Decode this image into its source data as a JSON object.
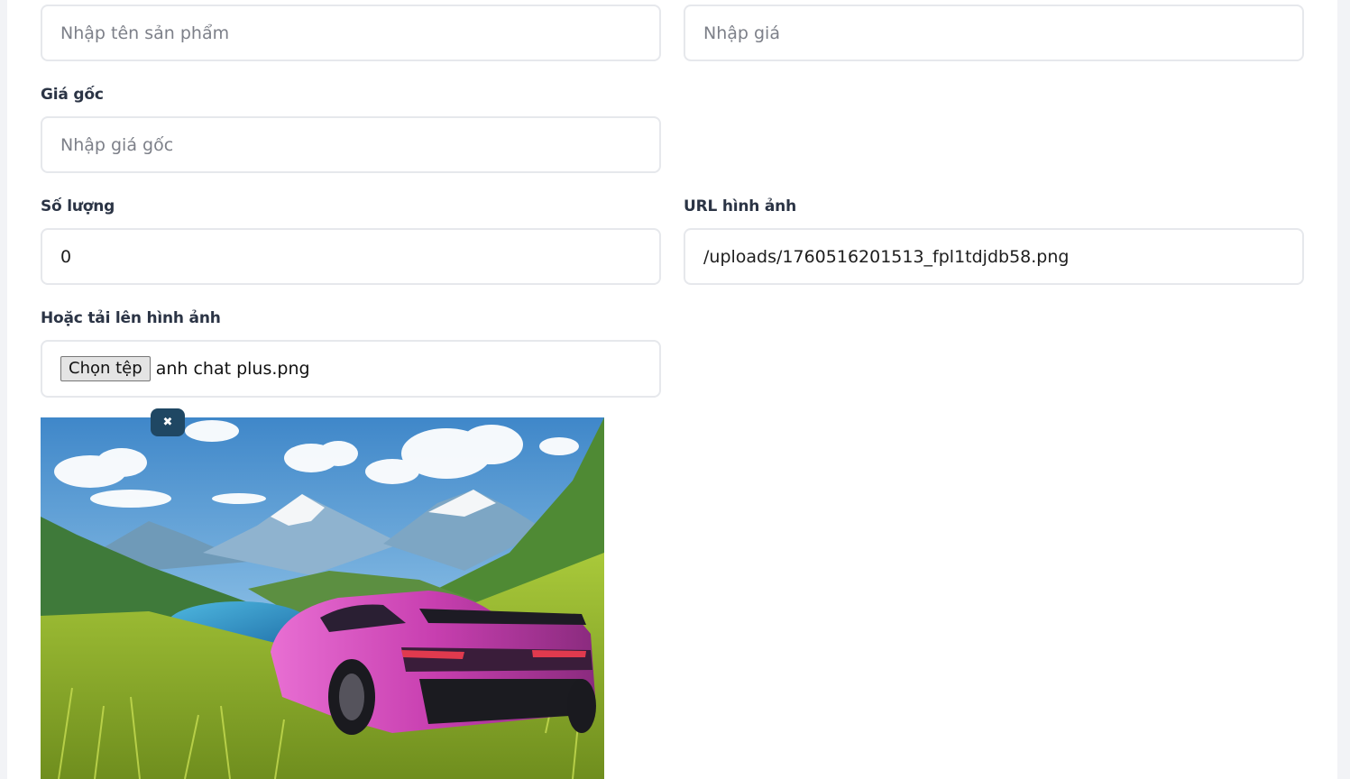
{
  "form": {
    "name_field": {
      "placeholder": "Nhập tên sản phẩm"
    },
    "price_field": {
      "placeholder": "Nhập giá"
    },
    "original_price": {
      "label": "Giá gốc",
      "placeholder": "Nhập giá gốc"
    },
    "quantity": {
      "label": "Số lượng",
      "value": "0"
    },
    "image_url": {
      "label": "URL hình ảnh",
      "value": "/uploads/1760516201513_fpl1tdjdb58.png"
    },
    "upload": {
      "label": "Hoặc tải lên hình ảnh",
      "button_label": "Chọn tệp",
      "file_name": "anh chat plus.png"
    }
  },
  "preview": {
    "remove_icon": "close-icon",
    "remove_symbol": "✖"
  },
  "colors": {
    "accent": "#1f4763",
    "label": "#2b3445",
    "border": "#e6e8ec"
  }
}
